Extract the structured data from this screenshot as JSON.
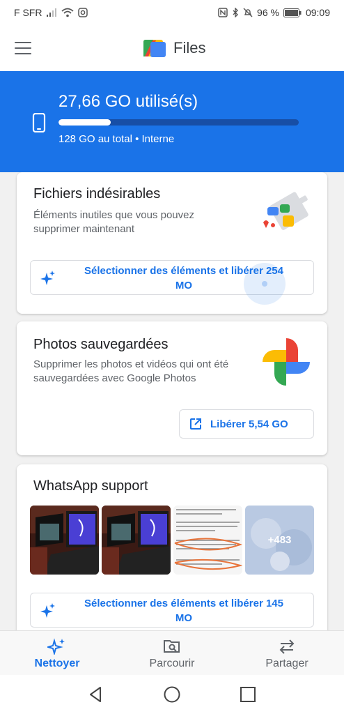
{
  "status_bar": {
    "carrier": "F SFR",
    "battery": "96 %",
    "time": "09:09"
  },
  "app_bar": {
    "title": "Files"
  },
  "storage": {
    "used": "27,66 GO utilisé(s)",
    "total": "128 GO au total • Interne",
    "used_fraction": 0.216
  },
  "cards": {
    "junk": {
      "title": "Fichiers indésirables",
      "description": "Éléments inutiles que vous pouvez supprimer maintenant",
      "action_line1": "Sélectionner des éléments et libérer 254",
      "action_line2": "MO"
    },
    "photos": {
      "title": "Photos sauvegardées",
      "description": "Supprimer les photos et vidéos qui ont été sauvegardées avec Google Photos",
      "action": "Libérer 5,54 GO"
    },
    "whatsapp": {
      "title": "WhatsApp support",
      "more_count": "+483",
      "action_line1": "Sélectionner des éléments et libérer 145",
      "action_line2": "MO"
    }
  },
  "bottom_nav": {
    "items": [
      {
        "label": "Nettoyer",
        "active": true
      },
      {
        "label": "Parcourir",
        "active": false
      },
      {
        "label": "Partager",
        "active": false
      }
    ]
  },
  "colors": {
    "accent": "#1a73e8",
    "header_bg": "#1a73e8"
  }
}
